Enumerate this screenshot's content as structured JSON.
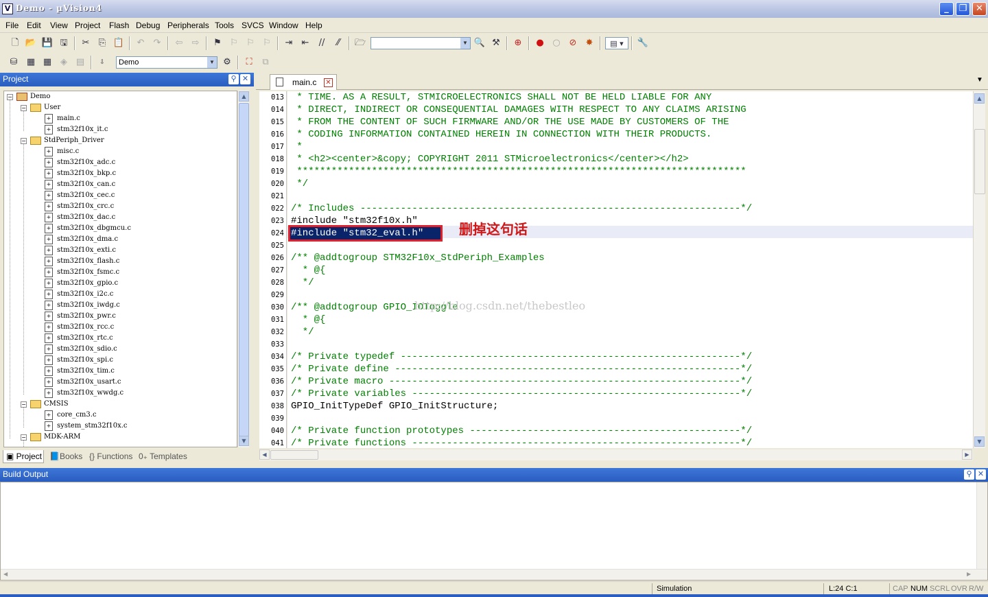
{
  "window": {
    "title": "Demo  - µVision4",
    "app_icon": "V"
  },
  "menu": [
    "File",
    "Edit",
    "View",
    "Project",
    "Flash",
    "Debug",
    "Peripherals",
    "Tools",
    "SVCS",
    "Window",
    "Help"
  ],
  "toolbar2": {
    "target_value": "Demo"
  },
  "project_panel": {
    "title": "Project",
    "tree": [
      {
        "label": "Demo",
        "level": 0,
        "kind": "root"
      },
      {
        "label": "User",
        "level": 1,
        "kind": "folder"
      },
      {
        "label": "main.c",
        "level": 2,
        "kind": "file"
      },
      {
        "label": "stm32f10x_it.c",
        "level": 2,
        "kind": "file"
      },
      {
        "label": "StdPeriph_Driver",
        "level": 1,
        "kind": "folder"
      },
      {
        "label": "misc.c",
        "level": 2,
        "kind": "file"
      },
      {
        "label": "stm32f10x_adc.c",
        "level": 2,
        "kind": "file"
      },
      {
        "label": "stm32f10x_bkp.c",
        "level": 2,
        "kind": "file"
      },
      {
        "label": "stm32f10x_can.c",
        "level": 2,
        "kind": "file"
      },
      {
        "label": "stm32f10x_cec.c",
        "level": 2,
        "kind": "file"
      },
      {
        "label": "stm32f10x_crc.c",
        "level": 2,
        "kind": "file"
      },
      {
        "label": "stm32f10x_dac.c",
        "level": 2,
        "kind": "file"
      },
      {
        "label": "stm32f10x_dbgmcu.c",
        "level": 2,
        "kind": "file"
      },
      {
        "label": "stm32f10x_dma.c",
        "level": 2,
        "kind": "file"
      },
      {
        "label": "stm32f10x_exti.c",
        "level": 2,
        "kind": "file"
      },
      {
        "label": "stm32f10x_flash.c",
        "level": 2,
        "kind": "file"
      },
      {
        "label": "stm32f10x_fsmc.c",
        "level": 2,
        "kind": "file"
      },
      {
        "label": "stm32f10x_gpio.c",
        "level": 2,
        "kind": "file"
      },
      {
        "label": "stm32f10x_i2c.c",
        "level": 2,
        "kind": "file"
      },
      {
        "label": "stm32f10x_iwdg.c",
        "level": 2,
        "kind": "file"
      },
      {
        "label": "stm32f10x_pwr.c",
        "level": 2,
        "kind": "file"
      },
      {
        "label": "stm32f10x_rcc.c",
        "level": 2,
        "kind": "file"
      },
      {
        "label": "stm32f10x_rtc.c",
        "level": 2,
        "kind": "file"
      },
      {
        "label": "stm32f10x_sdio.c",
        "level": 2,
        "kind": "file"
      },
      {
        "label": "stm32f10x_spi.c",
        "level": 2,
        "kind": "file"
      },
      {
        "label": "stm32f10x_tim.c",
        "level": 2,
        "kind": "file"
      },
      {
        "label": "stm32f10x_usart.c",
        "level": 2,
        "kind": "file"
      },
      {
        "label": "stm32f10x_wwdg.c",
        "level": 2,
        "kind": "file"
      },
      {
        "label": "CMSIS",
        "level": 1,
        "kind": "folder"
      },
      {
        "label": "core_cm3.c",
        "level": 2,
        "kind": "file"
      },
      {
        "label": "system_stm32f10x.c",
        "level": 2,
        "kind": "file"
      },
      {
        "label": "MDK-ARM",
        "level": 1,
        "kind": "folder"
      }
    ],
    "tabs": [
      "Project",
      "Books",
      "Functions",
      "Templates"
    ]
  },
  "editor": {
    "tab_label": "main.c",
    "lines": [
      {
        "num": "013",
        "text": " * TIME. AS A RESULT, STMICROELECTRONICS SHALL NOT BE HELD LIABLE FOR ANY",
        "style": "cmt"
      },
      {
        "num": "014",
        "text": " * DIRECT, INDIRECT OR CONSEQUENTIAL DAMAGES WITH RESPECT TO ANY CLAIMS ARISING",
        "style": "cmt"
      },
      {
        "num": "015",
        "text": " * FROM THE CONTENT OF SUCH FIRMWARE AND/OR THE USE MADE BY CUSTOMERS OF THE",
        "style": "cmt"
      },
      {
        "num": "016",
        "text": " * CODING INFORMATION CONTAINED HEREIN IN CONNECTION WITH THEIR PRODUCTS.",
        "style": "cmt"
      },
      {
        "num": "017",
        "text": " *",
        "style": "cmt"
      },
      {
        "num": "018",
        "text": " * <h2><center>&copy; COPYRIGHT 2011 STMicroelectronics</center></h2>",
        "style": "cmt"
      },
      {
        "num": "019",
        "text": " ******************************************************************************",
        "style": "cmt"
      },
      {
        "num": "020",
        "text": " */",
        "style": "cmt"
      },
      {
        "num": "021",
        "text": "",
        "style": "plain"
      },
      {
        "num": "022",
        "text": "/* Includes ------------------------------------------------------------------*/",
        "style": "cmt"
      },
      {
        "num": "023",
        "text": "#include \"stm32f10x.h\"",
        "style": "plain"
      },
      {
        "num": "024",
        "text": "",
        "style": "plain"
      },
      {
        "num": "025",
        "text": "",
        "style": "plain"
      },
      {
        "num": "026",
        "text": "/** @addtogroup STM32F10x_StdPeriph_Examples",
        "style": "cmt"
      },
      {
        "num": "027",
        "text": "  * @{",
        "style": "cmt"
      },
      {
        "num": "028",
        "text": "  */",
        "style": "cmt"
      },
      {
        "num": "029",
        "text": "",
        "style": "plain"
      },
      {
        "num": "030",
        "text": "/** @addtogroup GPIO_IOToggle",
        "style": "cmt"
      },
      {
        "num": "031",
        "text": "  * @{",
        "style": "cmt"
      },
      {
        "num": "032",
        "text": "  */",
        "style": "cmt"
      },
      {
        "num": "033",
        "text": "",
        "style": "plain"
      },
      {
        "num": "034",
        "text": "/* Private typedef -----------------------------------------------------------*/",
        "style": "cmt"
      },
      {
        "num": "035",
        "text": "/* Private define ------------------------------------------------------------*/",
        "style": "cmt"
      },
      {
        "num": "036",
        "text": "/* Private macro -------------------------------------------------------------*/",
        "style": "cmt"
      },
      {
        "num": "037",
        "text": "/* Private variables ---------------------------------------------------------*/",
        "style": "cmt"
      },
      {
        "num": "038",
        "text": "GPIO_InitTypeDef GPIO_InitStructure;",
        "style": "plain"
      },
      {
        "num": "039",
        "text": "",
        "style": "plain"
      },
      {
        "num": "040",
        "text": "/* Private function prototypes -----------------------------------------------*/",
        "style": "cmt"
      },
      {
        "num": "041",
        "text": "/* Private functions ---------------------------------------------------------*/",
        "style": "cmt"
      }
    ],
    "selected_text": "#include \"stm32_eval.h\"",
    "annotation": "删掉这句话",
    "watermark": "http://blog.csdn.net/thebestleo"
  },
  "build_output": {
    "title": "Build Output"
  },
  "status": {
    "mode": "Simulation",
    "position": "L:24 C:1",
    "flags": [
      "CAP",
      "NUM",
      "SCRL",
      "OVR",
      "R/W"
    ]
  },
  "colors": {
    "comment": "#008000",
    "selection": "#0a246a",
    "highlight_border": "#e0202a",
    "panel_header": "#2a5dbf"
  }
}
